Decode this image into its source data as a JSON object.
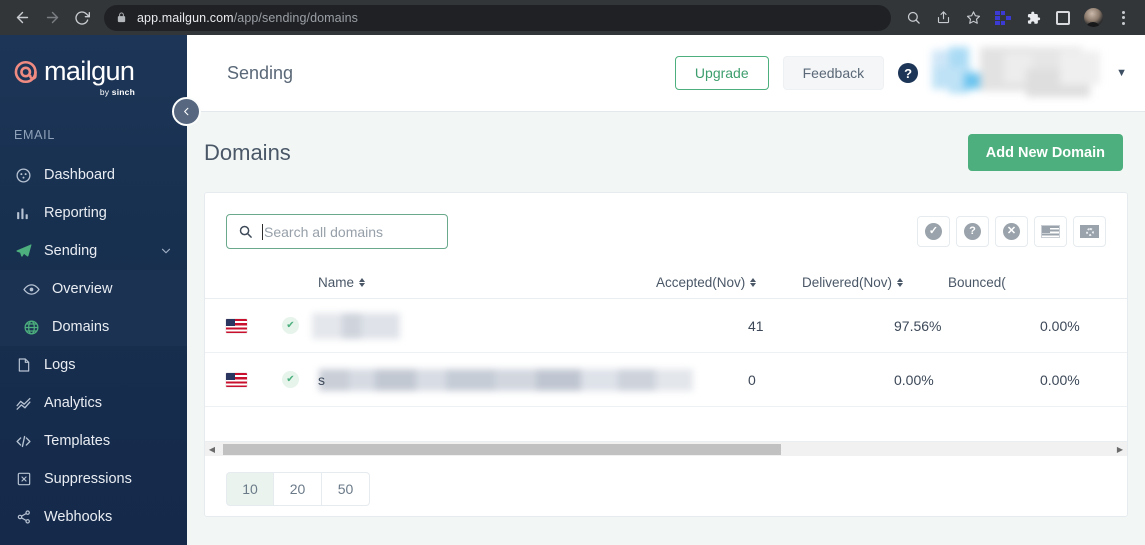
{
  "browser": {
    "back_icon": "back-arrow-icon",
    "forward_icon": "forward-arrow-icon",
    "reload_icon": "reload-icon",
    "lock_icon": "lock-icon",
    "url_host": "app.mailgun.com",
    "url_path": "/app/sending/domains",
    "icons": [
      "search-icon",
      "share-icon",
      "bookmark-star-icon",
      "extension-blue-icon",
      "extensions-puzzle-icon",
      "sidebar-panel-icon",
      "profile-avatar",
      "chrome-menu-icon"
    ]
  },
  "sidebar": {
    "logo_word": "mailgun",
    "logo_sub_prefix": "by ",
    "logo_sub_brand": "sinch",
    "section_label": "EMAIL",
    "items": [
      {
        "label": "Dashboard",
        "icon": "dashboard-icon"
      },
      {
        "label": "Reporting",
        "icon": "bar-chart-icon"
      },
      {
        "label": "Sending",
        "icon": "paper-plane-icon",
        "expanded": true,
        "chevron": "chevron-down-icon"
      }
    ],
    "sub_items": [
      {
        "label": "Overview",
        "icon": "eye-icon"
      },
      {
        "label": "Domains",
        "icon": "globe-icon",
        "active": true
      }
    ],
    "items_after": [
      {
        "label": "Logs",
        "icon": "document-icon"
      },
      {
        "label": "Analytics",
        "icon": "line-chart-icon"
      },
      {
        "label": "Templates",
        "icon": "code-brackets-icon"
      },
      {
        "label": "Suppressions",
        "icon": "x-box-icon"
      },
      {
        "label": "Webhooks",
        "icon": "share-nodes-icon"
      }
    ]
  },
  "header": {
    "collapse_icon": "chevron-left-icon",
    "kicker": "Sending",
    "upgrade_label": "Upgrade",
    "feedback_label": "Feedback",
    "help_label": "?",
    "account_caret": "▼"
  },
  "main": {
    "page_title": "Domains",
    "add_domain_label": "Add New Domain",
    "search": {
      "icon": "search-icon",
      "placeholder": "Search all domains",
      "value": ""
    },
    "filters": [
      {
        "name": "filter-verified",
        "icon": "check-circle-icon",
        "glyph": "✓"
      },
      {
        "name": "filter-unknown",
        "icon": "question-circle-icon",
        "glyph": "?"
      },
      {
        "name": "filter-disabled",
        "icon": "x-circle-icon",
        "glyph": "✕"
      },
      {
        "name": "filter-region-us",
        "icon": "us-flag-icon",
        "glyph": ""
      },
      {
        "name": "filter-region-eu",
        "icon": "eu-flag-icon",
        "glyph": ""
      }
    ],
    "table": {
      "columns": [
        {
          "label": "Name",
          "sortable": true
        },
        {
          "label": "Accepted(Nov)",
          "sortable": true
        },
        {
          "label": "Delivered(Nov)",
          "sortable": true
        },
        {
          "label": "Bounced(",
          "sortable": false
        }
      ],
      "rows": [
        {
          "region_icon": "us-flag-icon",
          "status_icon": "verified-check-icon",
          "name": "",
          "name_blurred": true,
          "accepted": "41",
          "delivered": "97.56%",
          "bounced": "0.00%"
        },
        {
          "region_icon": "us-flag-icon",
          "status_icon": "verified-check-icon",
          "name": "s",
          "name_blurred": true,
          "accepted": "0",
          "delivered": "0.00%",
          "bounced": "0.00%"
        }
      ]
    },
    "scrollbar": {
      "left_arrow": "◀",
      "right_arrow": "▶"
    },
    "page_sizes": [
      {
        "label": "10",
        "active": true
      },
      {
        "label": "20",
        "active": false
      },
      {
        "label": "50",
        "active": false
      }
    ]
  },
  "colors": {
    "brand_navy": "#1d3557",
    "brand_green": "#4caf7d",
    "page_bg": "#f2f7f6",
    "chrome_bg": "#323639"
  }
}
